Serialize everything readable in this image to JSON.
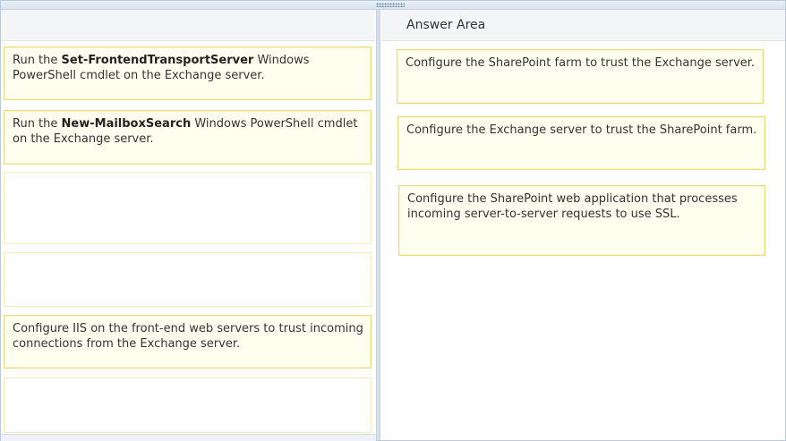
{
  "answer_area": {
    "title": "Answer Area"
  },
  "source_items": [
    {
      "prefix": "Run the ",
      "bold": "Set-FrontendTransportServer",
      "suffix": " Windows PowerShell cmdlet on the Exchange server."
    },
    {
      "prefix": "Run the ",
      "bold": "New-MailboxSearch",
      "suffix": " Windows PowerShell cmdlet on the Exchange server."
    },
    {
      "text": "Configure IIS on the front-end web servers to trust incoming connections from the Exchange server."
    }
  ],
  "answer_items": [
    {
      "text": "Configure the SharePoint farm to trust the Exchange server."
    },
    {
      "text": "Configure the Exchange server to trust the SharePoint farm."
    },
    {
      "text": "Configure the SharePoint web application that processes incoming server-to-server requests to use SSL."
    }
  ]
}
